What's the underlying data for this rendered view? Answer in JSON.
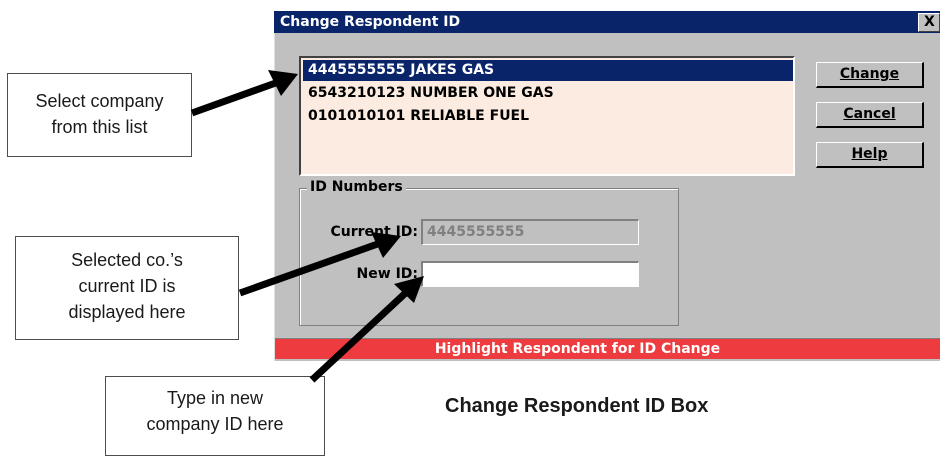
{
  "dialog": {
    "title": "Change Respondent ID",
    "close_glyph": "X",
    "list_items": [
      {
        "id": "4445555555",
        "name": "JAKES GAS",
        "text": "4445555555 JAKES GAS",
        "selected": true
      },
      {
        "id": "6543210123",
        "name": "NUMBER ONE GAS",
        "text": "6543210123 NUMBER ONE GAS",
        "selected": false
      },
      {
        "id": "0101010101",
        "name": "RELIABLE FUEL",
        "text": "0101010101 RELIABLE FUEL",
        "selected": false
      }
    ],
    "buttons": {
      "change": "Change",
      "cancel": "Cancel",
      "help": "Help"
    },
    "group": {
      "label": "ID Numbers",
      "current_id_label": "Current ID:",
      "current_id_value": "4445555555",
      "new_id_label": "New ID:",
      "new_id_value": ""
    },
    "status_text": "Highlight Respondent for ID Change",
    "colors": {
      "titlebar": "#0a246a",
      "selection": "#0a246a",
      "list_background": "#fbebe0",
      "status_bar": "#ee3b3f",
      "dialog_face": "#c0c0c0"
    }
  },
  "callouts": {
    "select_company": [
      "Select company",
      "from this list"
    ],
    "current_id": [
      "Selected co.’s",
      "current ID is",
      "displayed here"
    ],
    "new_id": [
      "Type in new",
      "company ID here"
    ]
  },
  "caption": "Change Respondent ID Box"
}
